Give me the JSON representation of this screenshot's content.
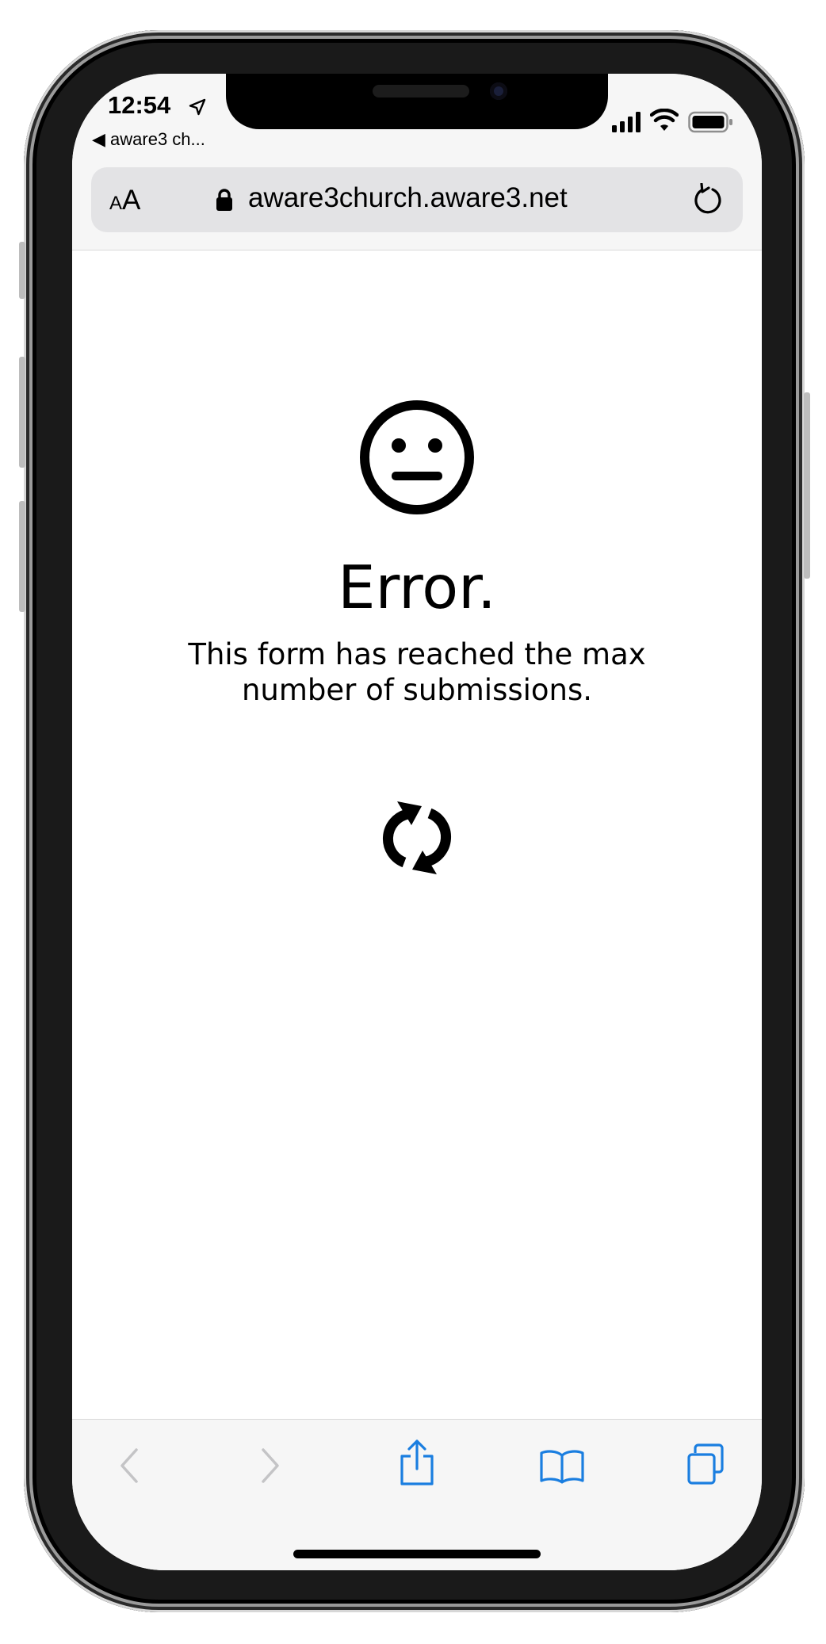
{
  "status_bar": {
    "time": "12:54",
    "back_app": "◀ aware3 ch..."
  },
  "address_bar": {
    "text_size_label": "AA",
    "url": "aware3church.aware3.net"
  },
  "page": {
    "title": "Error.",
    "message": "This form has reached the max number of submissions."
  },
  "icons": {
    "location": "location-arrow-icon",
    "signal": "cellular-signal-icon",
    "wifi": "wifi-icon",
    "battery": "battery-icon",
    "lock": "lock-icon",
    "reload": "reload-icon",
    "face": "neutral-face-icon",
    "refresh": "refresh-arrows-icon",
    "back": "chevron-left-icon",
    "forward": "chevron-right-icon",
    "share": "share-icon",
    "bookmarks": "book-icon",
    "tabs": "tabs-icon"
  },
  "colors": {
    "toolbar_blue": "#1a7ee0",
    "disabled_gray": "#c4c4c6"
  }
}
